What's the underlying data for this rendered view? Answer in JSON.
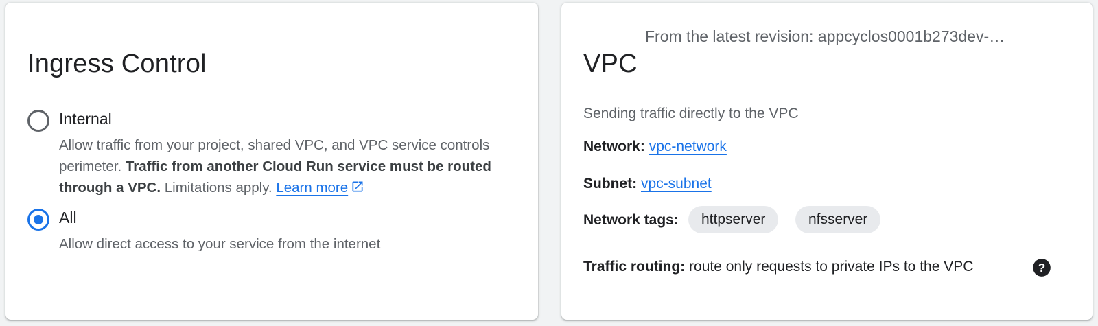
{
  "ingress": {
    "title": "Ingress Control",
    "options": [
      {
        "label": "Internal",
        "selected": false,
        "desc_plain_1": "Allow traffic from your project, shared VPC, and VPC service controls perimeter. ",
        "desc_bold": "Traffic from another Cloud Run service must be routed through a VPC.",
        "desc_plain_2": " Limitations apply. ",
        "link_label": "Learn more",
        "link_icon": "open-in-new-icon"
      },
      {
        "label": "All",
        "selected": true,
        "desc": "Allow direct access to your service from the internet"
      }
    ]
  },
  "vpc": {
    "revision_note": "From the latest revision: appcyclos0001b273dev-…",
    "title": "VPC",
    "sending_text": "Sending traffic directly to the VPC",
    "network_key": "Network:",
    "network_value": "vpc-network",
    "subnet_key": "Subnet:",
    "subnet_value": "vpc-subnet",
    "tags_key": "Network tags:",
    "tags": [
      "httpserver",
      "nfsserver"
    ],
    "routing_key": "Traffic routing:",
    "routing_value": "route only requests to private IPs to the VPC",
    "help_icon": "help-circle-icon"
  },
  "colors": {
    "accent": "#1a73e8",
    "chip_bg": "#e8eaed",
    "muted_text": "#5f6368"
  }
}
